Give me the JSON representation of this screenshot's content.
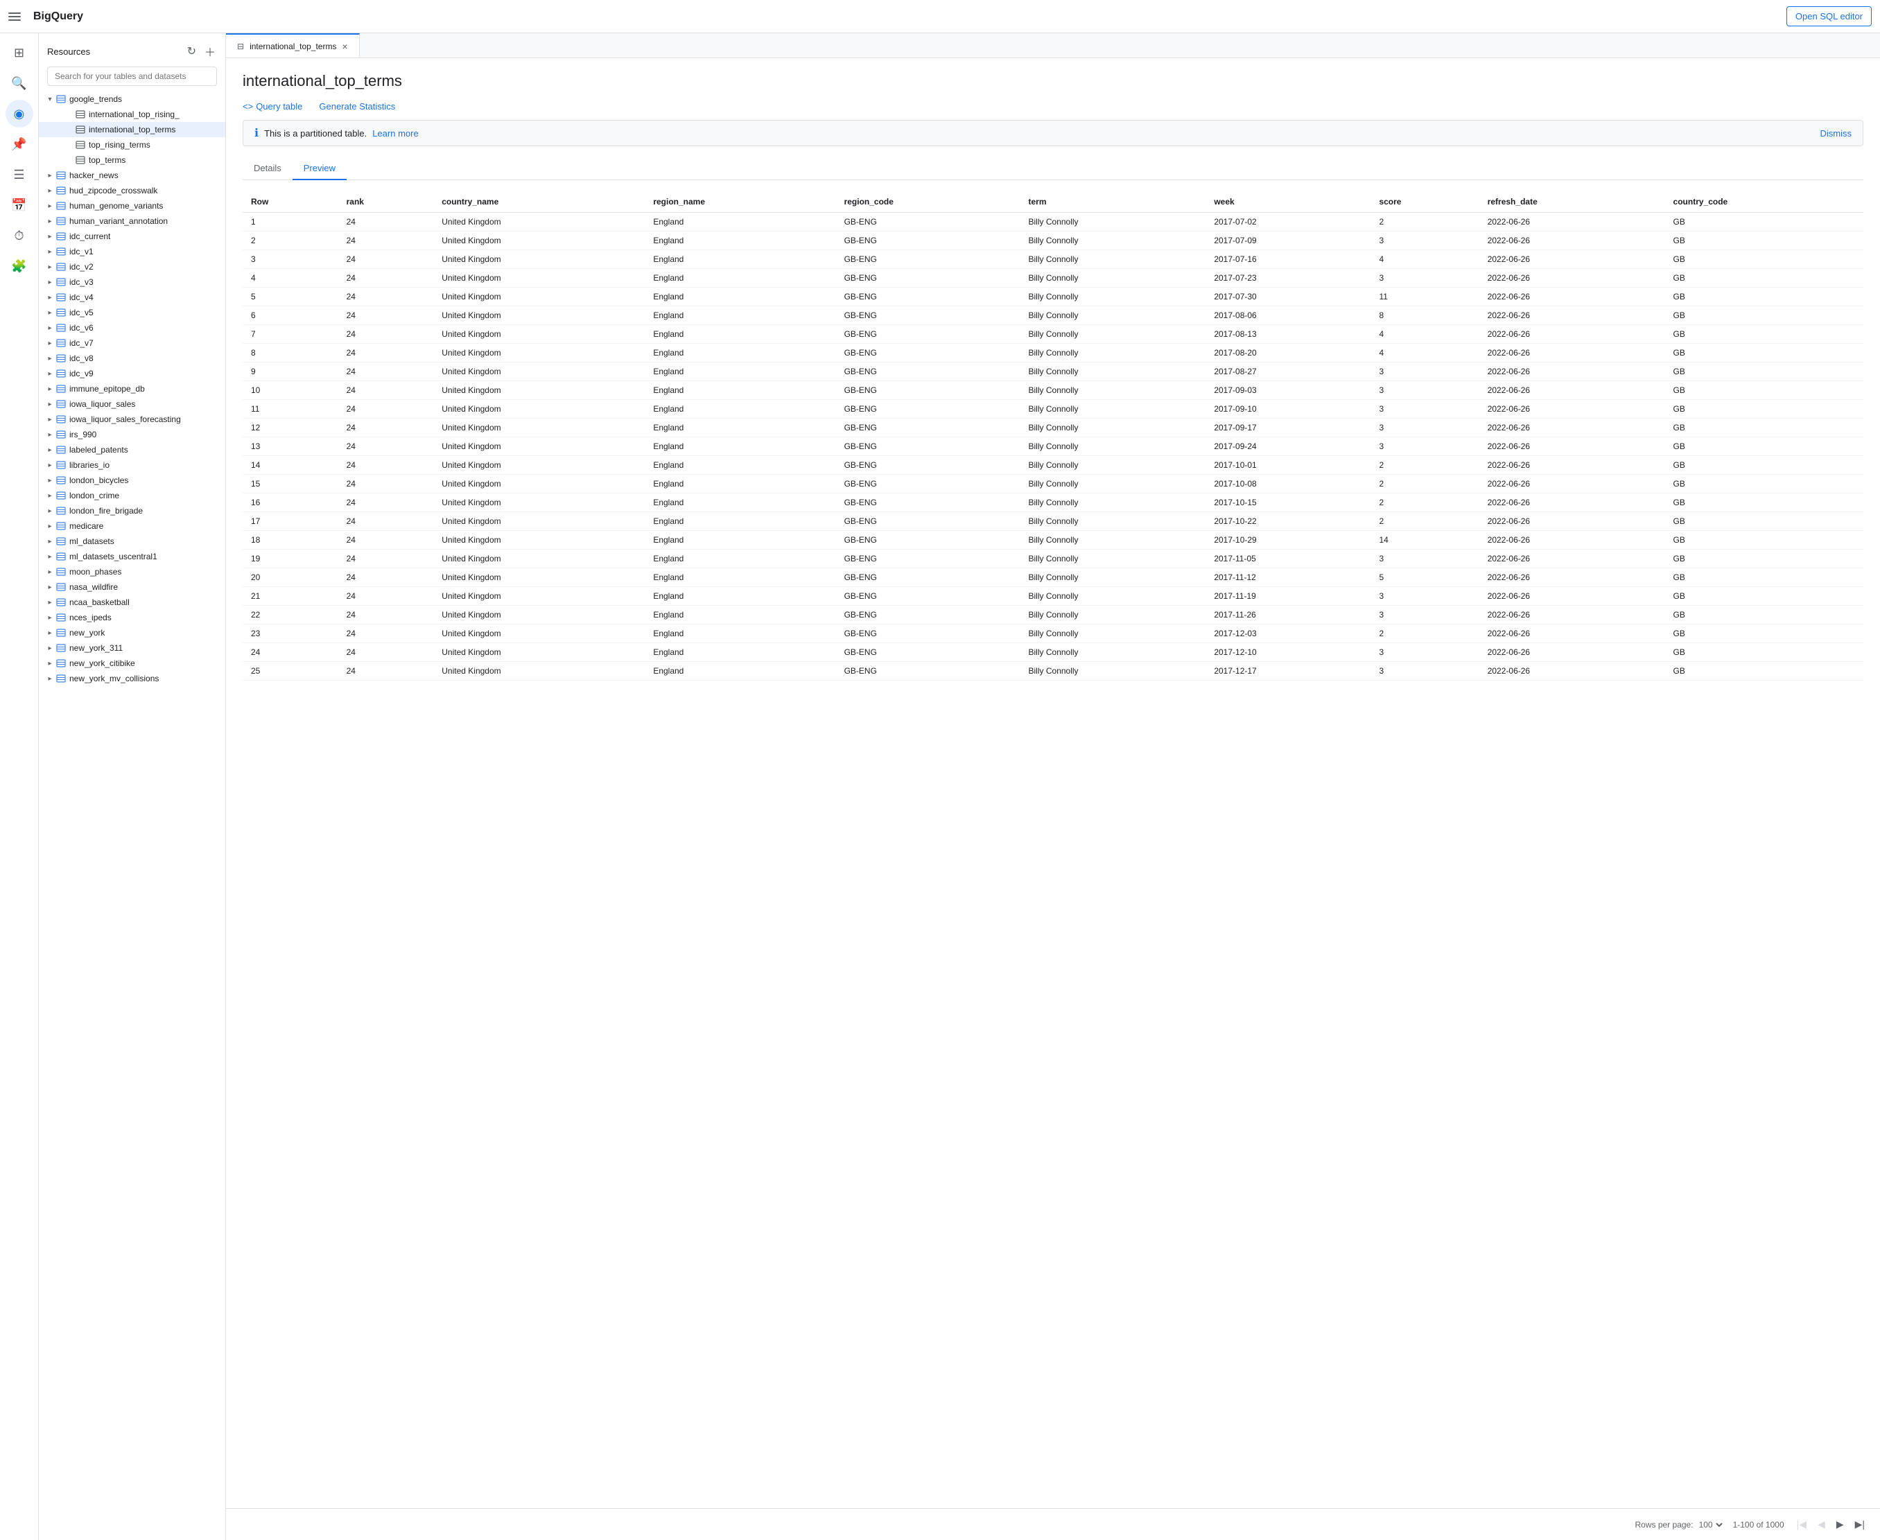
{
  "topBar": {
    "hamburger_label": "Menu",
    "logo": "BigQuery",
    "open_sql_label": "Open SQL editor"
  },
  "sidebar": {
    "title": "Resources",
    "refresh_label": "Refresh",
    "add_label": "Add",
    "search_placeholder": "Search for your tables and datasets",
    "tree": [
      {
        "id": "google_trends",
        "label": "google_trends",
        "level": 1,
        "type": "dataset",
        "expanded": true
      },
      {
        "id": "international_top_rising",
        "label": "international_top_rising_",
        "level": 2,
        "type": "table"
      },
      {
        "id": "international_top_terms",
        "label": "international_top_terms",
        "level": 2,
        "type": "table",
        "selected": true
      },
      {
        "id": "top_rising_terms",
        "label": "top_rising_terms",
        "level": 2,
        "type": "table"
      },
      {
        "id": "top_terms",
        "label": "top_terms",
        "level": 2,
        "type": "table"
      },
      {
        "id": "hacker_news",
        "label": "hacker_news",
        "level": 1,
        "type": "dataset"
      },
      {
        "id": "hud_zipcode_crosswalk",
        "label": "hud_zipcode_crosswalk",
        "level": 1,
        "type": "dataset"
      },
      {
        "id": "human_genome_variants",
        "label": "human_genome_variants",
        "level": 1,
        "type": "dataset"
      },
      {
        "id": "human_variant_annotation",
        "label": "human_variant_annotation",
        "level": 1,
        "type": "dataset"
      },
      {
        "id": "idc_current",
        "label": "idc_current",
        "level": 1,
        "type": "dataset"
      },
      {
        "id": "idc_v1",
        "label": "idc_v1",
        "level": 1,
        "type": "dataset"
      },
      {
        "id": "idc_v2",
        "label": "idc_v2",
        "level": 1,
        "type": "dataset"
      },
      {
        "id": "idc_v3",
        "label": "idc_v3",
        "level": 1,
        "type": "dataset"
      },
      {
        "id": "idc_v4",
        "label": "idc_v4",
        "level": 1,
        "type": "dataset"
      },
      {
        "id": "idc_v5",
        "label": "idc_v5",
        "level": 1,
        "type": "dataset"
      },
      {
        "id": "idc_v6",
        "label": "idc_v6",
        "level": 1,
        "type": "dataset"
      },
      {
        "id": "idc_v7",
        "label": "idc_v7",
        "level": 1,
        "type": "dataset"
      },
      {
        "id": "idc_v8",
        "label": "idc_v8",
        "level": 1,
        "type": "dataset"
      },
      {
        "id": "idc_v9",
        "label": "idc_v9",
        "level": 1,
        "type": "dataset"
      },
      {
        "id": "immune_epitope_db",
        "label": "immune_epitope_db",
        "level": 1,
        "type": "dataset"
      },
      {
        "id": "iowa_liquor_sales",
        "label": "iowa_liquor_sales",
        "level": 1,
        "type": "dataset"
      },
      {
        "id": "iowa_liquor_sales_forecasting",
        "label": "iowa_liquor_sales_forecasting",
        "level": 1,
        "type": "dataset"
      },
      {
        "id": "irs_990",
        "label": "irs_990",
        "level": 1,
        "type": "dataset"
      },
      {
        "id": "labeled_patents",
        "label": "labeled_patents",
        "level": 1,
        "type": "dataset"
      },
      {
        "id": "libraries_io",
        "label": "libraries_io",
        "level": 1,
        "type": "dataset"
      },
      {
        "id": "london_bicycles",
        "label": "london_bicycles",
        "level": 1,
        "type": "dataset"
      },
      {
        "id": "london_crime",
        "label": "london_crime",
        "level": 1,
        "type": "dataset"
      },
      {
        "id": "london_fire_brigade",
        "label": "london_fire_brigade",
        "level": 1,
        "type": "dataset"
      },
      {
        "id": "medicare",
        "label": "medicare",
        "level": 1,
        "type": "dataset"
      },
      {
        "id": "ml_datasets",
        "label": "ml_datasets",
        "level": 1,
        "type": "dataset"
      },
      {
        "id": "ml_datasets_uscentral1",
        "label": "ml_datasets_uscentral1",
        "level": 1,
        "type": "dataset"
      },
      {
        "id": "moon_phases",
        "label": "moon_phases",
        "level": 1,
        "type": "dataset"
      },
      {
        "id": "nasa_wildfire",
        "label": "nasa_wildfire",
        "level": 1,
        "type": "dataset"
      },
      {
        "id": "ncaa_basketball",
        "label": "ncaa_basketball",
        "level": 1,
        "type": "dataset"
      },
      {
        "id": "nces_ipeds",
        "label": "nces_ipeds",
        "level": 1,
        "type": "dataset"
      },
      {
        "id": "new_york",
        "label": "new_york",
        "level": 1,
        "type": "dataset"
      },
      {
        "id": "new_york_311",
        "label": "new_york_311",
        "level": 1,
        "type": "dataset"
      },
      {
        "id": "new_york_citibike",
        "label": "new_york_citibike",
        "level": 1,
        "type": "dataset"
      },
      {
        "id": "new_york_mv_collisions",
        "label": "new_york_mv_collisions",
        "level": 1,
        "type": "dataset"
      }
    ]
  },
  "tab": {
    "label": "international_top_terms",
    "close_label": "×"
  },
  "content": {
    "title": "international_top_terms",
    "query_table_label": "Query table",
    "generate_statistics_label": "Generate Statistics",
    "info_message": "This is a partitioned table.",
    "learn_more_label": "Learn more",
    "dismiss_label": "Dismiss",
    "sub_tabs": [
      "Details",
      "Preview"
    ],
    "active_sub_tab": "Preview"
  },
  "table": {
    "columns": [
      "Row",
      "rank",
      "country_name",
      "region_name",
      "region_code",
      "term",
      "week",
      "score",
      "refresh_date",
      "country_code"
    ],
    "rows": [
      [
        1,
        24,
        "United Kingdom",
        "England",
        "GB-ENG",
        "Billy Connolly",
        "2017-07-02",
        2,
        "2022-06-26",
        "GB"
      ],
      [
        2,
        24,
        "United Kingdom",
        "England",
        "GB-ENG",
        "Billy Connolly",
        "2017-07-09",
        3,
        "2022-06-26",
        "GB"
      ],
      [
        3,
        24,
        "United Kingdom",
        "England",
        "GB-ENG",
        "Billy Connolly",
        "2017-07-16",
        4,
        "2022-06-26",
        "GB"
      ],
      [
        4,
        24,
        "United Kingdom",
        "England",
        "GB-ENG",
        "Billy Connolly",
        "2017-07-23",
        3,
        "2022-06-26",
        "GB"
      ],
      [
        5,
        24,
        "United Kingdom",
        "England",
        "GB-ENG",
        "Billy Connolly",
        "2017-07-30",
        11,
        "2022-06-26",
        "GB"
      ],
      [
        6,
        24,
        "United Kingdom",
        "England",
        "GB-ENG",
        "Billy Connolly",
        "2017-08-06",
        8,
        "2022-06-26",
        "GB"
      ],
      [
        7,
        24,
        "United Kingdom",
        "England",
        "GB-ENG",
        "Billy Connolly",
        "2017-08-13",
        4,
        "2022-06-26",
        "GB"
      ],
      [
        8,
        24,
        "United Kingdom",
        "England",
        "GB-ENG",
        "Billy Connolly",
        "2017-08-20",
        4,
        "2022-06-26",
        "GB"
      ],
      [
        9,
        24,
        "United Kingdom",
        "England",
        "GB-ENG",
        "Billy Connolly",
        "2017-08-27",
        3,
        "2022-06-26",
        "GB"
      ],
      [
        10,
        24,
        "United Kingdom",
        "England",
        "GB-ENG",
        "Billy Connolly",
        "2017-09-03",
        3,
        "2022-06-26",
        "GB"
      ],
      [
        11,
        24,
        "United Kingdom",
        "England",
        "GB-ENG",
        "Billy Connolly",
        "2017-09-10",
        3,
        "2022-06-26",
        "GB"
      ],
      [
        12,
        24,
        "United Kingdom",
        "England",
        "GB-ENG",
        "Billy Connolly",
        "2017-09-17",
        3,
        "2022-06-26",
        "GB"
      ],
      [
        13,
        24,
        "United Kingdom",
        "England",
        "GB-ENG",
        "Billy Connolly",
        "2017-09-24",
        3,
        "2022-06-26",
        "GB"
      ],
      [
        14,
        24,
        "United Kingdom",
        "England",
        "GB-ENG",
        "Billy Connolly",
        "2017-10-01",
        2,
        "2022-06-26",
        "GB"
      ],
      [
        15,
        24,
        "United Kingdom",
        "England",
        "GB-ENG",
        "Billy Connolly",
        "2017-10-08",
        2,
        "2022-06-26",
        "GB"
      ],
      [
        16,
        24,
        "United Kingdom",
        "England",
        "GB-ENG",
        "Billy Connolly",
        "2017-10-15",
        2,
        "2022-06-26",
        "GB"
      ],
      [
        17,
        24,
        "United Kingdom",
        "England",
        "GB-ENG",
        "Billy Connolly",
        "2017-10-22",
        2,
        "2022-06-26",
        "GB"
      ],
      [
        18,
        24,
        "United Kingdom",
        "England",
        "GB-ENG",
        "Billy Connolly",
        "2017-10-29",
        14,
        "2022-06-26",
        "GB"
      ],
      [
        19,
        24,
        "United Kingdom",
        "England",
        "GB-ENG",
        "Billy Connolly",
        "2017-11-05",
        3,
        "2022-06-26",
        "GB"
      ],
      [
        20,
        24,
        "United Kingdom",
        "England",
        "GB-ENG",
        "Billy Connolly",
        "2017-11-12",
        5,
        "2022-06-26",
        "GB"
      ],
      [
        21,
        24,
        "United Kingdom",
        "England",
        "GB-ENG",
        "Billy Connolly",
        "2017-11-19",
        3,
        "2022-06-26",
        "GB"
      ],
      [
        22,
        24,
        "United Kingdom",
        "England",
        "GB-ENG",
        "Billy Connolly",
        "2017-11-26",
        3,
        "2022-06-26",
        "GB"
      ],
      [
        23,
        24,
        "United Kingdom",
        "England",
        "GB-ENG",
        "Billy Connolly",
        "2017-12-03",
        2,
        "2022-06-26",
        "GB"
      ],
      [
        24,
        24,
        "United Kingdom",
        "England",
        "GB-ENG",
        "Billy Connolly",
        "2017-12-10",
        3,
        "2022-06-26",
        "GB"
      ],
      [
        25,
        24,
        "United Kingdom",
        "England",
        "GB-ENG",
        "Billy Connolly",
        "2017-12-17",
        3,
        "2022-06-26",
        "GB"
      ]
    ]
  },
  "footer": {
    "rows_per_page_label": "Rows per page:",
    "rows_per_page_value": "100",
    "pagination_label": "1-100 of 1000",
    "first_page_label": "First page",
    "prev_page_label": "Previous page",
    "next_page_label": "Next page",
    "last_page_label": "Last page"
  },
  "leftNav": {
    "icons": [
      {
        "name": "grid-icon",
        "symbol": "⊞",
        "active": false
      },
      {
        "name": "search-icon",
        "symbol": "🔍",
        "active": false
      },
      {
        "name": "database-icon",
        "symbol": "◉",
        "active": true
      },
      {
        "name": "pin-icon",
        "symbol": "📌",
        "active": false
      },
      {
        "name": "list-icon",
        "symbol": "☰",
        "active": false
      },
      {
        "name": "calendar-icon",
        "symbol": "📅",
        "active": false
      },
      {
        "name": "clock-icon",
        "symbol": "⏱",
        "active": false
      },
      {
        "name": "puzzle-icon",
        "symbol": "🧩",
        "active": false
      }
    ]
  }
}
